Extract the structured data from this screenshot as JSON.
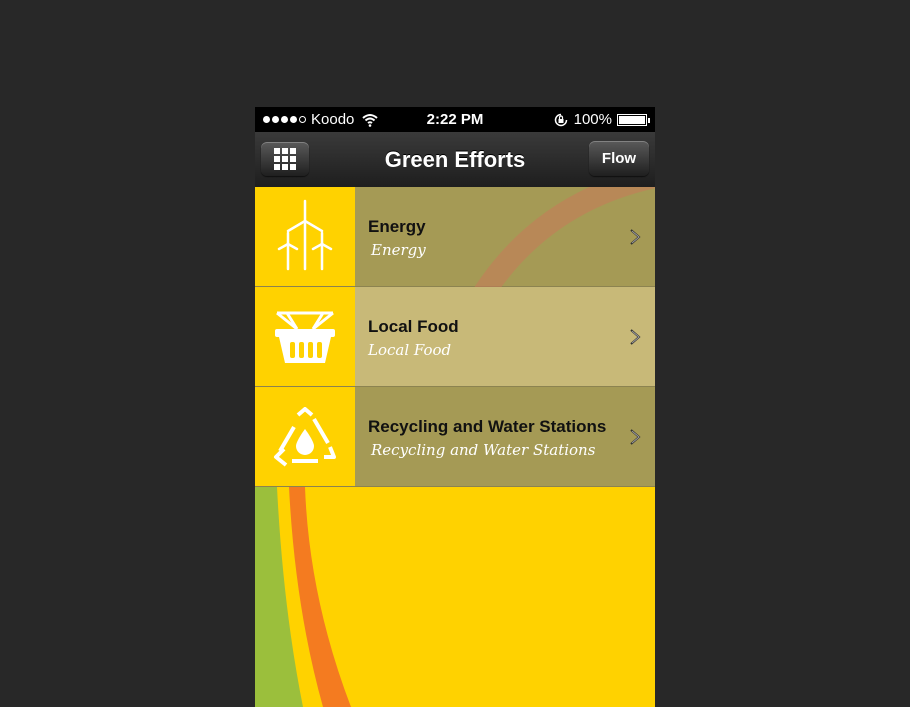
{
  "status_bar": {
    "carrier": "Koodo",
    "time": "2:22 PM",
    "battery": "100%"
  },
  "nav": {
    "title": "Green Efforts",
    "flow_label": "Flow"
  },
  "items": [
    {
      "title": "Energy",
      "subtitle": "Energy",
      "icon": "wind-turbine-icon"
    },
    {
      "title": "Local Food",
      "subtitle": "Local Food",
      "icon": "basket-icon"
    },
    {
      "title": "Recycling and Water Stations",
      "subtitle": "Recycling and Water Stations",
      "icon": "recycling-water-icon"
    }
  ],
  "colors": {
    "accent": "#ffd200",
    "row_dark": "#a59a55",
    "row_light": "#c8b978",
    "stripe_orange": "#f47b20",
    "stripe_green": "#9bbf3c"
  }
}
